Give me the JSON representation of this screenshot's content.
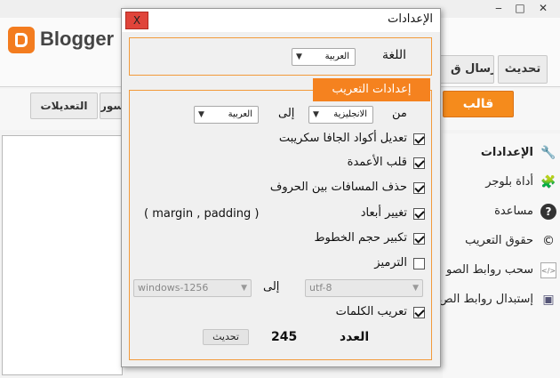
{
  "main_window": {
    "window_controls": {
      "minimize": "‒",
      "maximize": "□",
      "close": "✕"
    },
    "logo_text": "Blogger",
    "header_buttons": {
      "refresh": "تحديث",
      "send_partial": "إرسال ق"
    },
    "toolbar": {
      "template_label": "قالب",
      "images_partial": "سور",
      "edits_label": "التعديلات"
    },
    "right_menu": [
      {
        "label": "الإعدادات",
        "icon": "wrench-icon",
        "bold": true
      },
      {
        "label": "أداة بلوجر",
        "icon": "puzzle-icon",
        "bold": false
      },
      {
        "label": "مساعدة",
        "icon": "help-icon",
        "bold": false
      },
      {
        "label": "حقوق التعريب",
        "icon": "copyright-icon",
        "bold": false
      },
      {
        "label": "سحب روابط الصو",
        "icon": "code-file-icon",
        "bold": false
      },
      {
        "label": "إستبدال روابط الص",
        "icon": "image-icon",
        "bold": false
      }
    ]
  },
  "dialog": {
    "title": "الإعدادات",
    "close_label": "X",
    "language_label": "اللغة",
    "language_value": "العربية",
    "localization_tab": "إعدادات التعريب",
    "from_label": "من",
    "from_value": "الانجليزية",
    "to_label": "إلى",
    "to_value": "العربية",
    "options": [
      {
        "label": "تعديل أكواد الجافا سكريبت",
        "checked": true
      },
      {
        "label": "قلب الأعمدة",
        "checked": true
      },
      {
        "label": "حذف المسافات بين الحروف",
        "checked": true
      },
      {
        "label": "تغيير أبعاد",
        "checked": true
      },
      {
        "label": "تكبير حجم الخطوط",
        "checked": true
      },
      {
        "label": "الترميز",
        "checked": false
      }
    ],
    "dimension_note": "( margin , padding )",
    "encoding_from": "utf-8",
    "encoding_to_label": "إلى",
    "encoding_to": "windows-1256",
    "localize_words": {
      "label": "تعريب الكلمات",
      "checked": true
    },
    "update_button": "تحديث",
    "count_value": "245",
    "count_label": "العدد"
  }
}
